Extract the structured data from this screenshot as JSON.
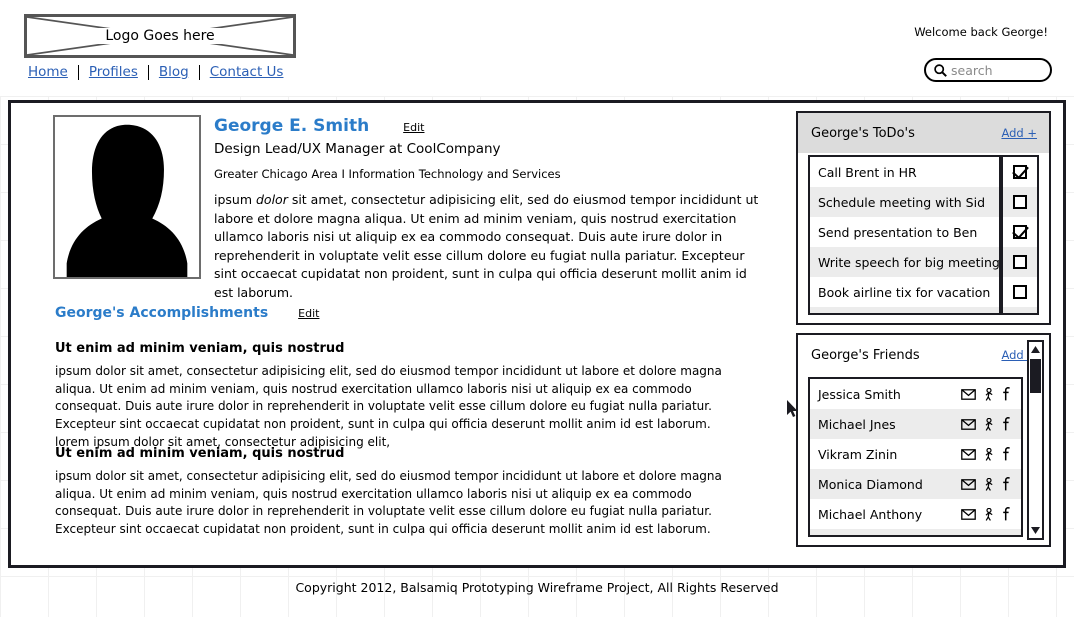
{
  "header": {
    "logo_text": "Logo Goes here",
    "welcome": "Welcome back George!",
    "nav": [
      {
        "label": "Home"
      },
      {
        "label": "Profiles"
      },
      {
        "label": "Blog"
      },
      {
        "label": "Contact Us"
      }
    ],
    "search": {
      "placeholder": "search",
      "value": "",
      "icon": "search-icon"
    }
  },
  "profile": {
    "photo_alt": "avatar-silhouette",
    "name": "George E. Smith",
    "edit_label": "Edit",
    "title": "Design Lead/UX Manager at CoolCompany",
    "meta": "Greater Chicago Area I Information Technology and Services",
    "bio_pre": "ipsum ",
    "bio_em": "dolor",
    "bio_post": " sit amet, consectetur adipisicing elit, sed do eiusmod tempor incididunt ut labore et dolore magna aliqua. Ut enim ad minim veniam, quis nostrud exercitation ullamco laboris nisi ut aliquip ex ea commodo consequat. Duis aute irure dolor in reprehenderit in voluptate velit esse cillum dolore eu fugiat nulla pariatur. Excepteur sint occaecat cupidatat non proident, sunt in culpa qui officia deserunt mollit anim id est laborum."
  },
  "accomplishments": {
    "title": "George's Accomplishments",
    "edit_label": "Edit",
    "blocks": [
      {
        "heading": "Ut enim ad minim veniam, quis nostrud",
        "body": "ipsum dolor sit amet, consectetur adipisicing elit, sed do eiusmod tempor incididunt ut labore et dolore magna aliqua. Ut enim ad minim veniam, quis nostrud exercitation ullamco laboris nisi ut aliquip ex ea commodo consequat. Duis aute irure dolor in reprehenderit in voluptate velit esse cillum dolore eu fugiat nulla pariatur. Excepteur sint occaecat cupidatat non proident, sunt in culpa qui officia deserunt mollit anim id est laborum. lorem ipsum dolor sit amet, consectetur adipisicing elit,"
      },
      {
        "heading": "Ut enim ad minim veniam, quis nostrud",
        "body": "ipsum dolor sit amet, consectetur adipisicing elit, sed do eiusmod tempor incididunt ut labore et dolore magna aliqua. Ut enim ad minim veniam, quis nostrud exercitation ullamco laboris nisi ut aliquip ex ea commodo consequat. Duis aute irure dolor in reprehenderit in voluptate velit esse cillum dolore eu fugiat nulla pariatur. Excepteur sint occaecat cupidatat non proident, sunt in culpa qui officia deserunt mollit anim id est laborum."
      }
    ]
  },
  "todo_panel": {
    "title": "George's ToDo's",
    "add_label": "Add +",
    "items": [
      {
        "label": "Call Brent in HR",
        "checked": true
      },
      {
        "label": "Schedule meeting with Sid",
        "checked": false
      },
      {
        "label": "Send presentation to Ben",
        "checked": true
      },
      {
        "label": "Write speech for big meeting",
        "checked": false
      },
      {
        "label": "Book airline tix for vacation",
        "checked": false
      }
    ]
  },
  "friends_panel": {
    "title": "George's Friends",
    "add_label": "Add +",
    "icons": [
      "envelope-icon",
      "person-icon",
      "facebook-icon"
    ],
    "items": [
      {
        "name": "Jessica Smith"
      },
      {
        "name": "Michael Jnes"
      },
      {
        "name": "Vikram Zinin"
      },
      {
        "name": "Monica Diamond"
      },
      {
        "name": "Michael Anthony"
      }
    ],
    "scrollbar": {
      "up_icon": "triangle-up-icon",
      "down_icon": "triangle-down-icon"
    }
  },
  "footer": {
    "copyright": "Copyright 2012, Balsamiq Prototyping Wireframe Project, All Rights Reserved"
  },
  "colors": {
    "link_blue": "#2b5fb5",
    "heading_blue": "#2b7cc9",
    "frame_black": "#1b1b22",
    "panel_header_gray": "#dcdcdc",
    "row_stripe_gray": "#ececec"
  }
}
